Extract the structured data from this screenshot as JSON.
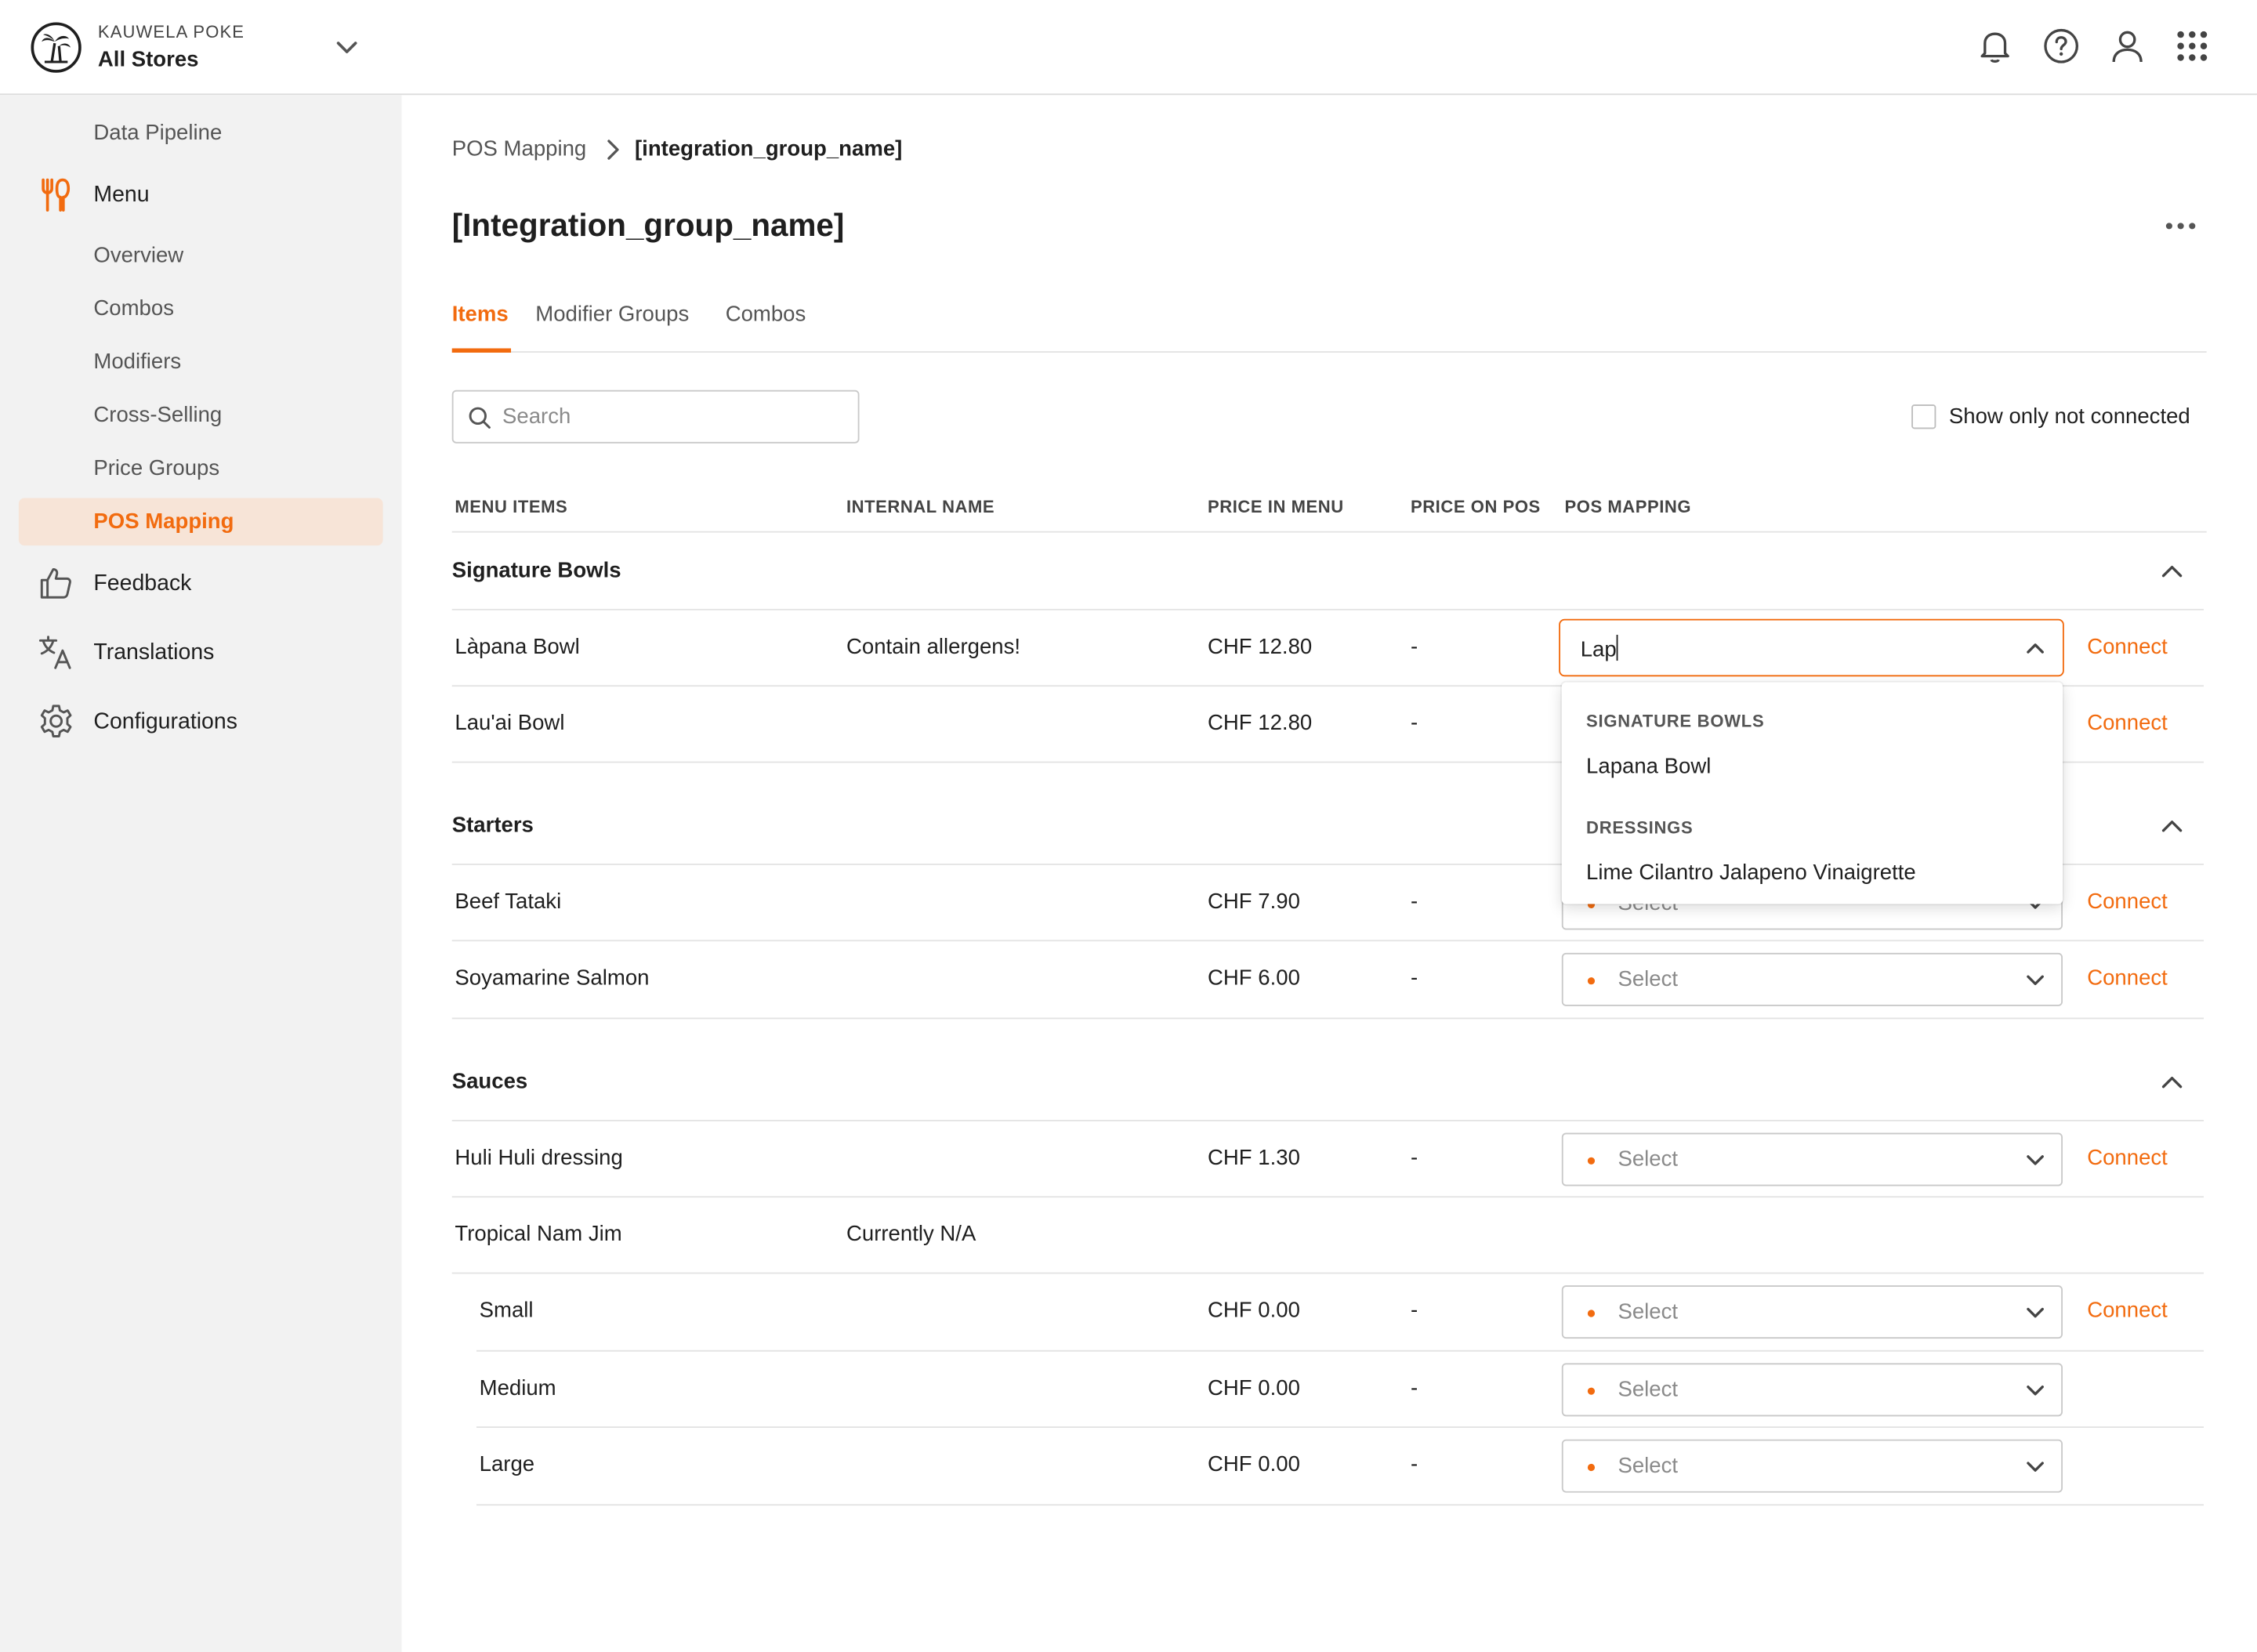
{
  "header": {
    "org_name": "KAUWELA POKE",
    "store_selector": "All Stores",
    "icons": [
      "bell-icon",
      "help-icon",
      "user-icon",
      "apps-grid-icon"
    ]
  },
  "sidebar": {
    "items": [
      {
        "label": "Data Pipeline",
        "level": "sub"
      },
      {
        "label": "Menu",
        "level": "main",
        "icon": "fork-knife-icon"
      },
      {
        "label": "Overview",
        "level": "sub"
      },
      {
        "label": "Combos",
        "level": "sub"
      },
      {
        "label": "Modifiers",
        "level": "sub"
      },
      {
        "label": "Cross-Selling",
        "level": "sub"
      },
      {
        "label": "Price Groups",
        "level": "sub"
      },
      {
        "label": "POS Mapping",
        "level": "sub",
        "active": true
      },
      {
        "label": "Feedback",
        "level": "main",
        "icon": "thumbs-up-icon"
      },
      {
        "label": "Translations",
        "level": "main",
        "icon": "translate-icon"
      },
      {
        "label": "Configurations",
        "level": "main",
        "icon": "gear-icon"
      }
    ]
  },
  "breadcrumb": {
    "parent": "POS Mapping",
    "current": "[integration_group_name]"
  },
  "page_title": "[Integration_group_name]",
  "tabs": [
    {
      "label": "Items",
      "active": true
    },
    {
      "label": "Modifier Groups"
    },
    {
      "label": "Combos"
    }
  ],
  "search": {
    "placeholder": "Search",
    "value": ""
  },
  "filter": {
    "label": "Show only not connected",
    "checked": false
  },
  "table": {
    "columns": [
      "MENU ITEMS",
      "INTERNAL NAME",
      "PRICE IN MENU",
      "PRICE ON POS",
      "POS MAPPING"
    ],
    "groups": [
      {
        "name": "Signature Bowls",
        "rows": [
          {
            "item": "Làpana Bowl",
            "internal": "Contain allergens!",
            "price_menu": "CHF 12.80",
            "price_pos": "-",
            "mapping": "Lap",
            "mapping_open": true,
            "action": "Connect"
          },
          {
            "item": "Lau'ai Bowl",
            "internal": "",
            "price_menu": "CHF 12.80",
            "price_pos": "-",
            "action": "Connect"
          }
        ]
      },
      {
        "name": "Starters",
        "rows": [
          {
            "item": "Beef Tataki",
            "internal": "",
            "price_menu": "CHF 7.90",
            "price_pos": "-",
            "mapping": "Select",
            "action": "Connect"
          },
          {
            "item": "Soyamarine Salmon",
            "internal": "",
            "price_menu": "CHF 6.00",
            "price_pos": "-",
            "mapping": "Select",
            "action": "Connect"
          }
        ]
      },
      {
        "name": "Sauces",
        "rows": [
          {
            "item": "Huli Huli dressing",
            "internal": "",
            "price_menu": "CHF 1.30",
            "price_pos": "-",
            "mapping": "Select",
            "action": "Connect"
          },
          {
            "item": "Tropical Nam Jim",
            "internal": "Currently N/A",
            "variants": [
              {
                "item": "Small",
                "price_menu": "CHF 0.00",
                "price_pos": "-",
                "mapping": "Select",
                "action": "Connect"
              },
              {
                "item": "Medium",
                "price_menu": "CHF 0.00",
                "price_pos": "-",
                "mapping": "Select"
              },
              {
                "item": "Large",
                "price_menu": "CHF 0.00",
                "price_pos": "-",
                "mapping": "Select"
              }
            ]
          }
        ]
      }
    ]
  },
  "dropdown": {
    "sections": [
      {
        "group": "SIGNATURE BOWLS",
        "options": [
          "Lapana Bowl"
        ]
      },
      {
        "group": "DRESSINGS",
        "options": [
          "Lime Cilantro Jalapeno Vinaigrette"
        ]
      }
    ]
  },
  "colors": {
    "accent": "#f26b0f",
    "sidebar_bg": "#f2f2f2",
    "active_nav_bg": "#f7e4d7",
    "border": "#e3e3e3"
  }
}
